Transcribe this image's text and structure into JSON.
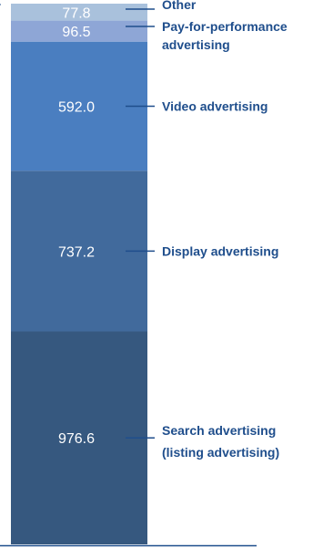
{
  "chart_data": {
    "type": "bar",
    "stacked": true,
    "categories": [
      ""
    ],
    "series": [
      {
        "name": "Search advertising (listing advertising)",
        "value_label": "976.6",
        "values": [
          976.6
        ],
        "color": "#36587f"
      },
      {
        "name": "Display advertising",
        "value_label": "737.2",
        "values": [
          737.2
        ],
        "color": "#416a9c"
      },
      {
        "name": "Video advertising",
        "value_label": "592.0",
        "values": [
          592.0
        ],
        "color": "#4a7ec0"
      },
      {
        "name": "Pay-for-performance advertising",
        "value_label": "96.5",
        "values": [
          96.5
        ],
        "color": "#8ea6d6"
      },
      {
        "name": "Other",
        "value_label": "77.8",
        "values": [
          77.8
        ],
        "color": "#a9c1dc"
      }
    ],
    "legend_labels": [
      {
        "key": "search",
        "lines": [
          "Search advertising",
          "(listing advertising)"
        ]
      },
      {
        "key": "display",
        "lines": [
          "Display advertising"
        ]
      },
      {
        "key": "video",
        "lines": [
          "Video advertising"
        ]
      },
      {
        "key": "pfp",
        "lines": [
          "Pay-for-performance",
          "advertising"
        ]
      },
      {
        "key": "other",
        "lines": [
          "Other"
        ]
      }
    ],
    "legend_placement": "right",
    "title": "",
    "xlabel": "",
    "ylabel": "",
    "grid": false,
    "label_color": "#1f4e8c",
    "value_text_color": "#ffffff"
  }
}
